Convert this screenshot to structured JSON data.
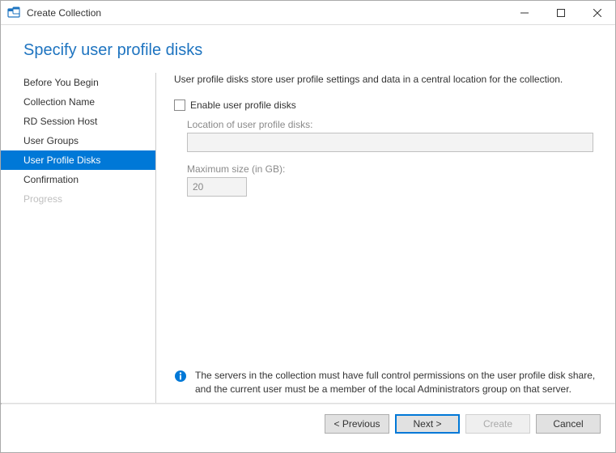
{
  "window": {
    "title": "Create Collection"
  },
  "page": {
    "heading": "Specify user profile disks"
  },
  "sidebar": {
    "items": [
      {
        "label": "Before You Begin"
      },
      {
        "label": "Collection Name"
      },
      {
        "label": "RD Session Host"
      },
      {
        "label": "User Groups"
      },
      {
        "label": "User Profile Disks"
      },
      {
        "label": "Confirmation"
      },
      {
        "label": "Progress"
      }
    ]
  },
  "main": {
    "description": "User profile disks store user profile settings and data in a central location for the collection.",
    "enable_checkbox_label": "Enable user profile disks",
    "location_label": "Location of user profile disks:",
    "location_value": "",
    "maxsize_label": "Maximum size (in GB):",
    "maxsize_value": "20",
    "info_text": "The servers in the collection must have full control permissions on the user profile disk share, and the current user must be a member of the local Administrators group on that server."
  },
  "footer": {
    "previous": "< Previous",
    "next": "Next >",
    "create": "Create",
    "cancel": "Cancel"
  }
}
